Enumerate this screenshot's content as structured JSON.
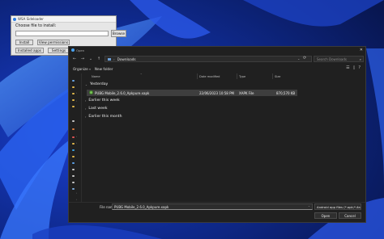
{
  "sideloader": {
    "title": "WSA Sideloader",
    "choose_label": "Choose file to install:",
    "path_value": "",
    "browse": "Browse",
    "install": "Install",
    "view_permissions": "View permissions",
    "installed_apps": "Installed apps",
    "settings": "Settings"
  },
  "dialog": {
    "title": "Open",
    "address": {
      "current": "Downloads"
    },
    "search_placeholder": "Search Downloads",
    "commands": {
      "organize": "Organize",
      "new_folder": "New folder"
    },
    "columns": {
      "name": "Name",
      "date_modified": "Date modified",
      "type": "Type",
      "size": "Size"
    },
    "groups": {
      "yesterday": "Yesterday",
      "earlier_this_week": "Earlier this week",
      "last_week": "Last week",
      "earlier_this_month": "Earlier this month"
    },
    "file": {
      "name": "PUBG Mobile_2.6.0_Apkpure.xapk",
      "date": "22/06/2023 10:58 PM",
      "type": "XAPK File",
      "size": "870,570 KB"
    },
    "footer": {
      "file_name_label": "File name:",
      "file_name_value": "PUBG Mobile_2.6.0_Apkpure.xapk",
      "file_type": "Android app files (*.apk;*.xapk)",
      "open": "Open",
      "cancel": "Cancel"
    }
  },
  "colors": {
    "dialog_bg": "#202020",
    "selection": "#3e3e3e",
    "sideloader_bg": "#e6e6e6",
    "accent": "#2d7de0"
  }
}
